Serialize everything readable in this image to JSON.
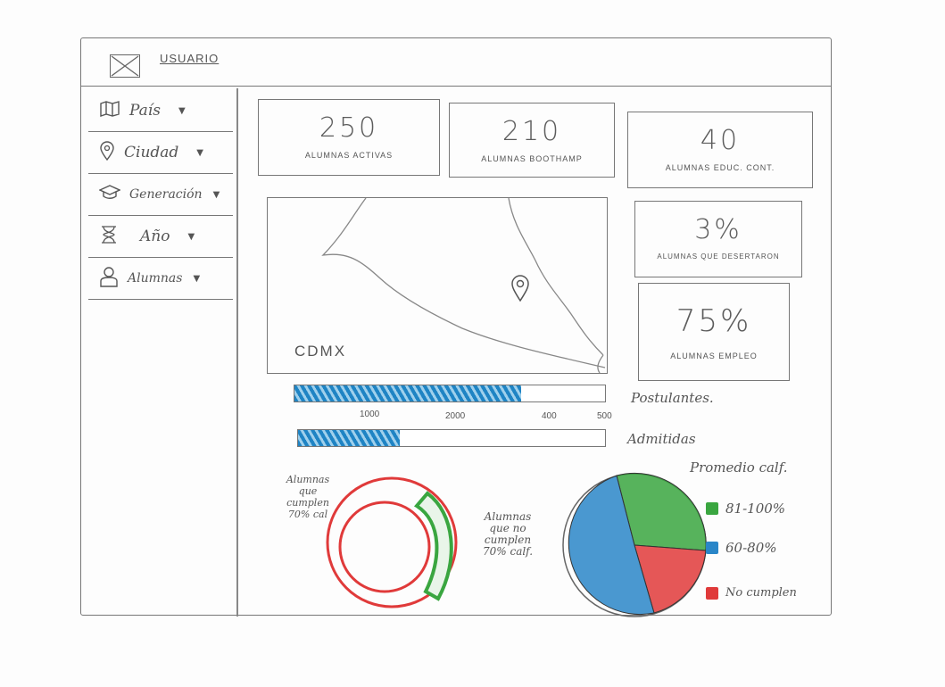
{
  "header": {
    "user_link": "USUARIO"
  },
  "sidebar": {
    "items": [
      {
        "label": "País",
        "icon": "map-icon"
      },
      {
        "label": "Ciudad",
        "icon": "pin-icon"
      },
      {
        "label": "Generación",
        "icon": "graduation-cap-icon"
      },
      {
        "label": "Año",
        "icon": "hourglass-icon"
      },
      {
        "label": "Alumnas",
        "icon": "user-icon"
      }
    ]
  },
  "kpis": [
    {
      "value": "250",
      "caption": "ALUMNAS ACTIVAS"
    },
    {
      "value": "210",
      "caption": "ALUMNAS BOOTHAMP"
    },
    {
      "value": "40",
      "caption": "ALUMNAS EDUC. CONT."
    },
    {
      "value": "3%",
      "caption": "ALUMNAS QUE DESERTARON"
    },
    {
      "value": "75%",
      "caption": "ALUMNAS EMPLEO"
    }
  ],
  "map": {
    "label": "CDMX"
  },
  "progress": {
    "postulantes": {
      "label": "Postulantes.",
      "fraction": 0.73
    },
    "admitidas": {
      "label": "Admitidas",
      "fraction": 0.33
    },
    "ticks": [
      "1000",
      "2000",
      "400",
      "500"
    ]
  },
  "donut": {
    "note_left": "Alumnas que cumplen 70% cal",
    "note_right": "Alumnas que no cumplen 70% calf.",
    "cumplen_color": "#e03a3a",
    "no_cumplen_color": "#3aa640"
  },
  "pie": {
    "title": "Promedio calf.",
    "legend": [
      {
        "label": "81-100%",
        "color": "#3aa640"
      },
      {
        "label": "60-80%",
        "color": "#2a86c8"
      },
      {
        "label": "No cumplen",
        "color": "#e03a3a"
      }
    ]
  },
  "colors": {
    "blue": "#1f84c4",
    "green": "#3aa640",
    "red": "#e03a3a"
  }
}
